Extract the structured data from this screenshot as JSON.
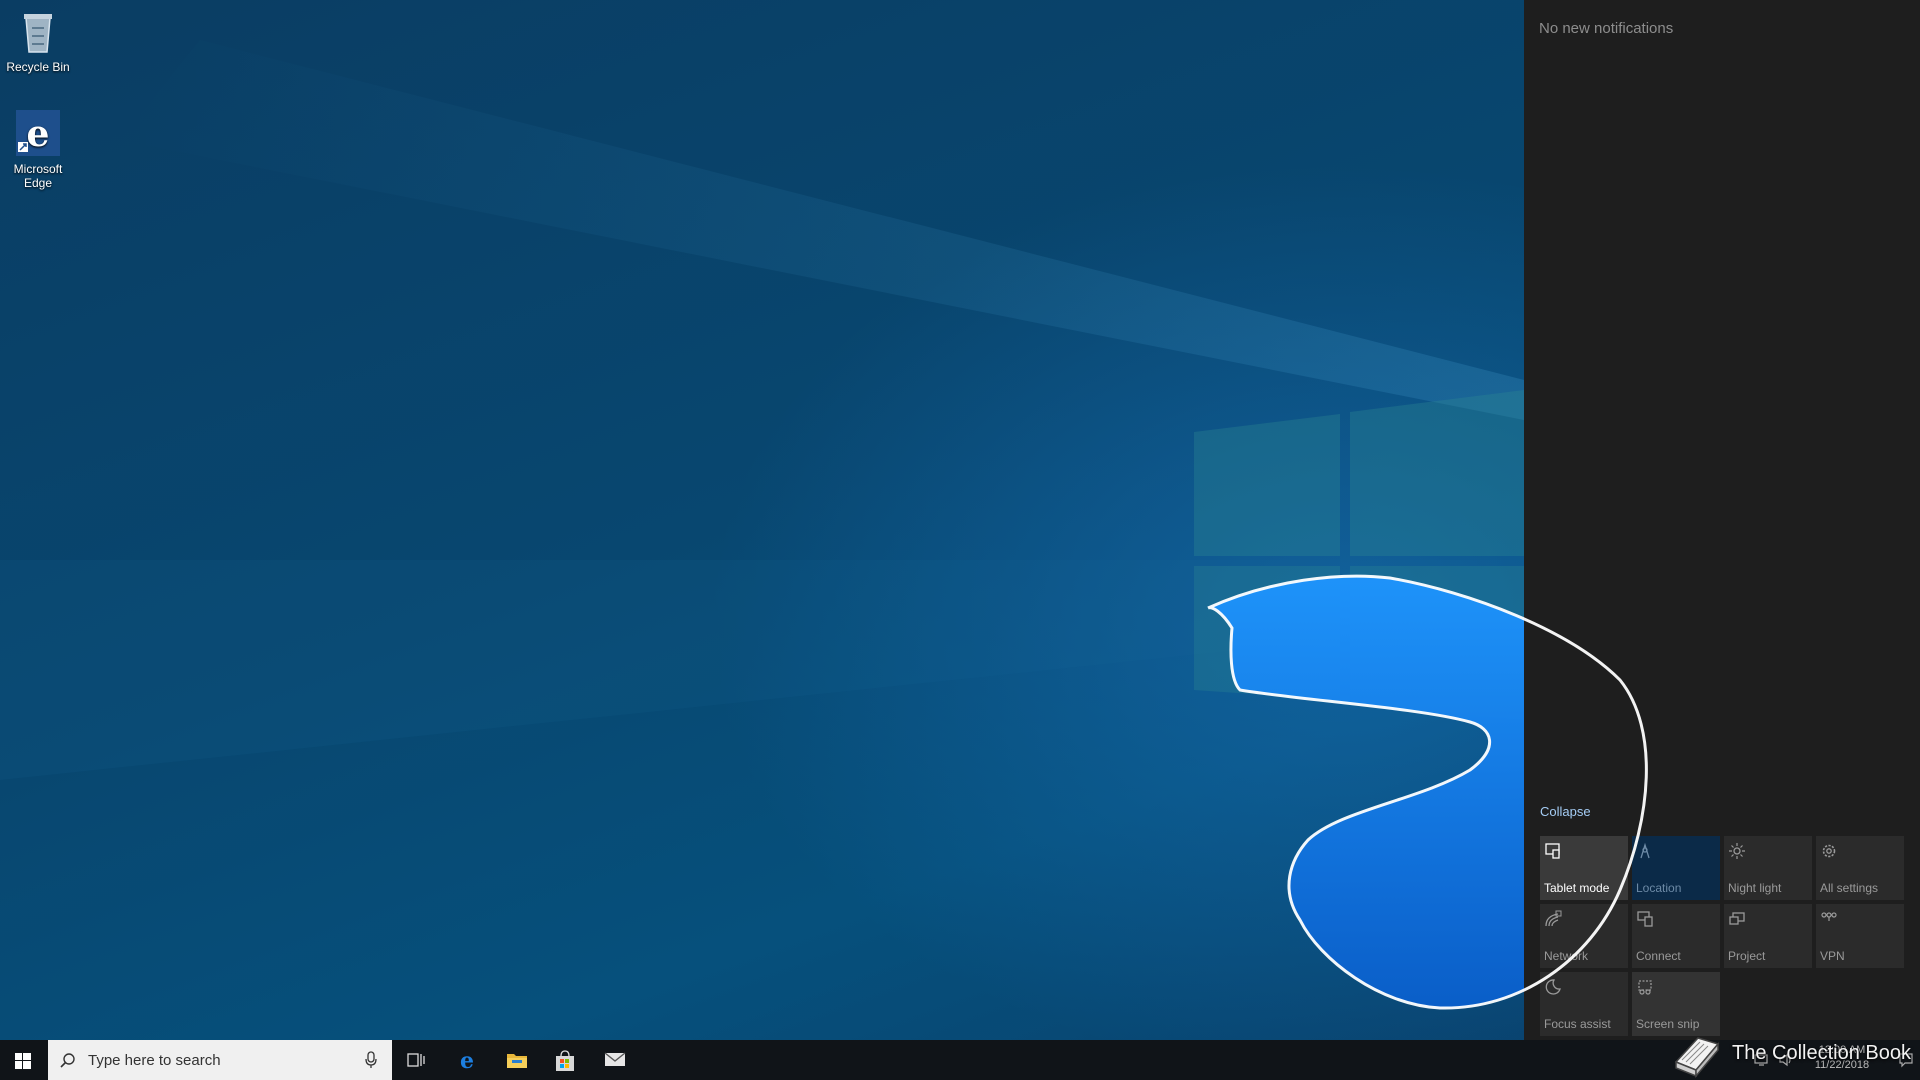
{
  "desktop": {
    "icons": [
      {
        "label": "Recycle Bin",
        "icon": "recycle-bin-icon"
      },
      {
        "label": "Microsoft Edge",
        "icon": "edge-icon"
      }
    ]
  },
  "action_center": {
    "notifications_text": "No new notifications",
    "collapse_label": "Collapse",
    "tiles": [
      {
        "label": "Tablet mode",
        "icon": "tablet-mode-icon",
        "state": "on"
      },
      {
        "label": "Location",
        "icon": "location-icon",
        "state": "blue"
      },
      {
        "label": "Night light",
        "icon": "night-light-icon",
        "state": "off"
      },
      {
        "label": "All settings",
        "icon": "gear-icon",
        "state": "off"
      },
      {
        "label": "Network",
        "icon": "network-icon",
        "state": "off"
      },
      {
        "label": "Connect",
        "icon": "connect-icon",
        "state": "off"
      },
      {
        "label": "Project",
        "icon": "project-icon",
        "state": "off"
      },
      {
        "label": "VPN",
        "icon": "vpn-icon",
        "state": "off"
      },
      {
        "label": "Focus assist",
        "icon": "moon-icon",
        "state": "off"
      },
      {
        "label": "Screen snip",
        "icon": "screen-snip-icon",
        "state": "off"
      }
    ]
  },
  "taskbar": {
    "search_placeholder": "Type here to search",
    "pinned_apps": [
      "task-view-icon",
      "edge-icon",
      "file-explorer-icon",
      "store-icon",
      "mail-icon"
    ],
    "clock": {
      "time": "12:00 AM",
      "date": "11/22/2018"
    }
  },
  "watermark": {
    "text": "The Collection Book"
  },
  "colors": {
    "accent": "#1e90ff",
    "action_center_bg": "#1e1e1e",
    "taskbar_bg": "#101418",
    "highlight_blue": "#1a8cf0"
  }
}
